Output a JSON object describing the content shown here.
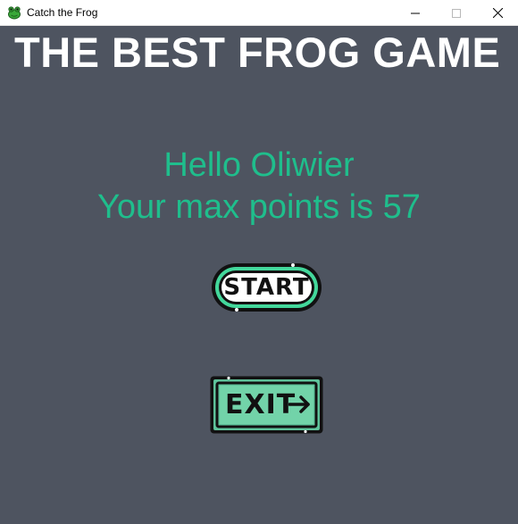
{
  "window": {
    "title": "Catch the Frog",
    "icon": "frog-icon"
  },
  "game": {
    "headline": "THE BEST FROG GAME",
    "greeting": "Hello Oliwier",
    "score_line": "Your max points is 57",
    "start_label": "START",
    "exit_label": "EXIT"
  },
  "colors": {
    "background": "#4e5460",
    "accent_text": "#1fbe8c",
    "start_ring": "#43d79b",
    "exit_fill": "#5ec29a"
  }
}
